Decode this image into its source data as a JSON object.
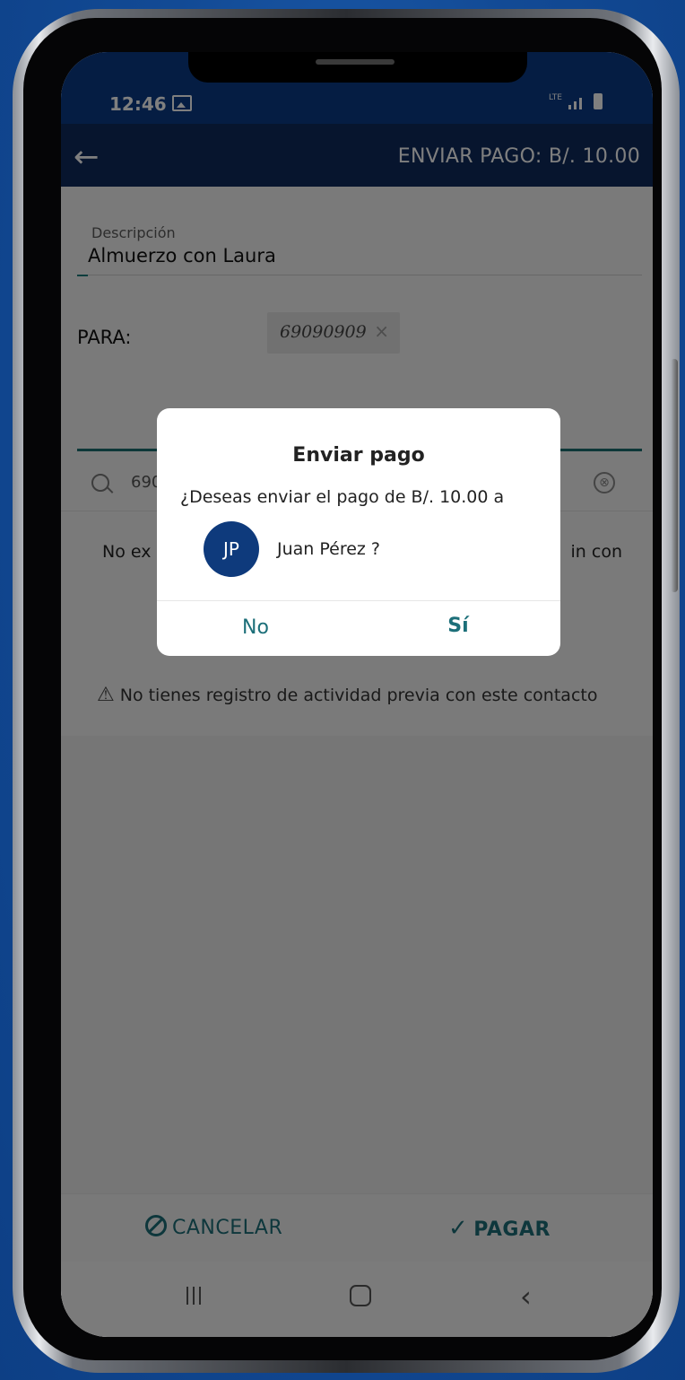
{
  "status_bar": {
    "time": "12:46",
    "network": "LTE"
  },
  "app_bar": {
    "back_label": "←",
    "title": "ENVIAR PAGO: B/. 10.00"
  },
  "form": {
    "description_label": "Descripción",
    "description_value": "Almuerzo con Laura",
    "para_label": "PARA:",
    "recipient_chip": "69090909",
    "recipient_chip_close": "×",
    "search_value": "690",
    "clear_icon": "⊗",
    "no_results_start": "No ex",
    "no_results_end": "in con",
    "warning_text": "No tienes registro de actividad previa con este contacto"
  },
  "dialog": {
    "title": "Enviar pago",
    "message": "¿Deseas enviar el pago de B/. 10.00 a",
    "avatar_initials": "JP",
    "contact_name": "Juan Pérez ?",
    "no_label": "No",
    "yes_label": "Sí"
  },
  "actions": {
    "cancel_label": "CANCELAR",
    "pay_label": "PAGAR"
  },
  "nav": {
    "back_glyph": "‹"
  },
  "colors": {
    "primary_dark": "#0e2a5c",
    "accent_teal": "#1c6f79",
    "avatar_bg": "#0e3a7c"
  },
  "icons": [
    "back-arrow-icon",
    "gallery-icon",
    "signal-icon",
    "battery-icon",
    "chip-close-icon",
    "search-icon",
    "clear-icon",
    "warning-icon",
    "cancel-icon",
    "check-icon",
    "recent-apps-icon",
    "home-icon",
    "nav-back-icon"
  ]
}
